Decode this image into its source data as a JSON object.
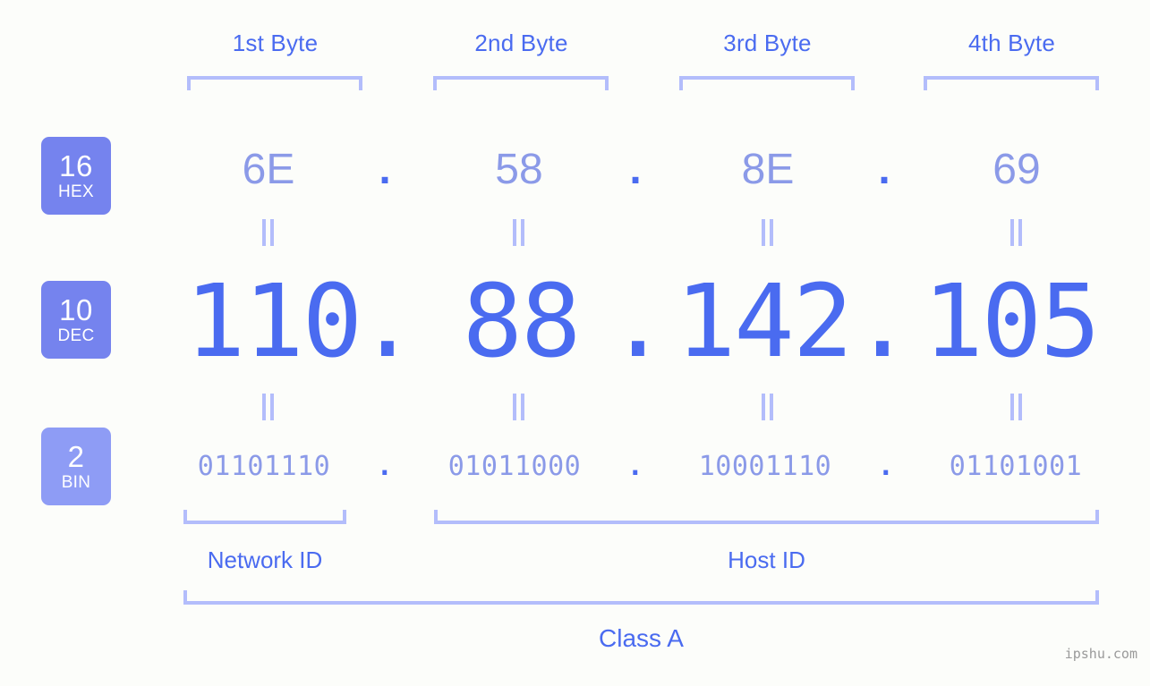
{
  "background_color": "#fcfdfa",
  "accent_color": "#4a6bf0",
  "light_accent_color": "#8b9ae8",
  "bracket_color": "#b3bdfb",
  "badge_color": "#7583ee",
  "badge_color_bin": "#8e9cf5",
  "byte_headers": [
    {
      "label": "1st Byte"
    },
    {
      "label": "2nd Byte"
    },
    {
      "label": "3rd Byte"
    },
    {
      "label": "4th Byte"
    }
  ],
  "rows": {
    "hex": {
      "badge_number": "16",
      "badge_word": "HEX",
      "values": [
        "6E",
        "58",
        "8E",
        "69"
      ],
      "separator": "."
    },
    "dec": {
      "badge_number": "10",
      "badge_word": "DEC",
      "values": [
        "110",
        "88",
        "142",
        "105"
      ],
      "separator": "."
    },
    "bin": {
      "badge_number": "2",
      "badge_word": "BIN",
      "values": [
        "01101110",
        "01011000",
        "10001110",
        "01101001"
      ],
      "separator": "."
    }
  },
  "regions": [
    {
      "label": "Network ID"
    },
    {
      "label": "Host ID"
    }
  ],
  "class": {
    "label": "Class A"
  },
  "watermark": {
    "text": "ipshu.com"
  }
}
